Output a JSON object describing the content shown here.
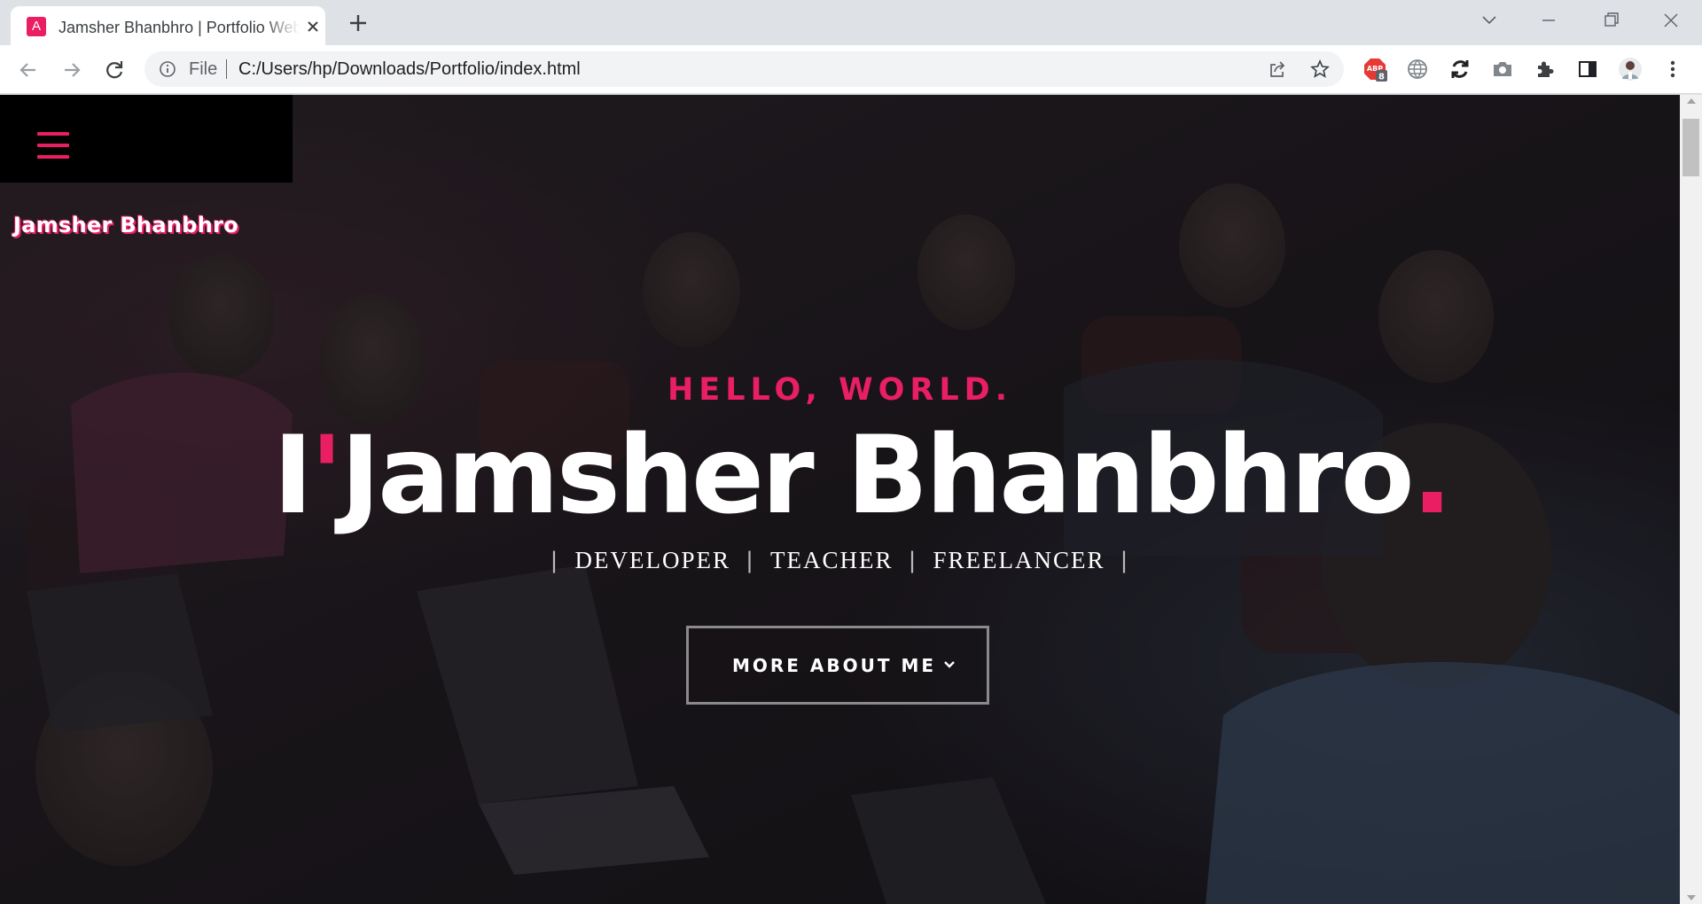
{
  "browser": {
    "tab": {
      "favicon_letter": "A",
      "title": "Jamsher Bhanbhro | Portfolio Website"
    },
    "address": {
      "scheme": "File",
      "url": "C:/Users/hp/Downloads/Portfolio/index.html"
    },
    "extensions": {
      "adblock_badge": "8"
    }
  },
  "page": {
    "site_name": "Jamsher Bhanbhro",
    "hero": {
      "kicker": "HELLO, WORLD.",
      "name_prefix": "I",
      "name_apostrophe": "'",
      "name": "Jamsher Bhanbhro",
      "name_dot": ".",
      "roles": [
        "DEVELOPER",
        "TEACHER",
        "FREELANCER"
      ],
      "separator": "|",
      "cta_label": "MORE ABOUT ME"
    }
  },
  "colors": {
    "accent": "#e91e63",
    "chrome_bg": "#dee1e6",
    "hero_text": "#ffffff"
  }
}
